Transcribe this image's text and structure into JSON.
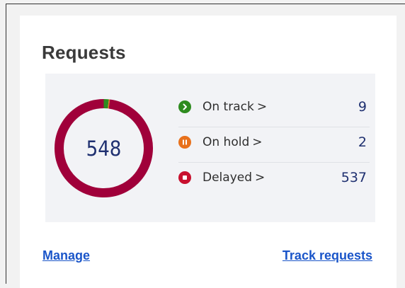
{
  "card": {
    "title": "Requests",
    "total": "548"
  },
  "statuses": [
    {
      "label": "On track",
      "chevron": ">",
      "count": "9",
      "icon": "play-icon",
      "color": "#2e8b1f"
    },
    {
      "label": "On hold",
      "chevron": ">",
      "count": "2",
      "icon": "pause-icon",
      "color": "#e8711c"
    },
    {
      "label": "Delayed",
      "chevron": ">",
      "count": "537",
      "icon": "stop-icon",
      "color": "#c8102e"
    }
  ],
  "donut": {
    "segments": [
      {
        "name": "On track",
        "value": 9,
        "color": "#2e8b1f"
      },
      {
        "name": "On hold",
        "value": 2,
        "color": "#e8711c"
      },
      {
        "name": "Delayed",
        "value": 537,
        "color": "#a0003a"
      }
    ]
  },
  "links": {
    "manage": "Manage",
    "track": "Track requests"
  }
}
